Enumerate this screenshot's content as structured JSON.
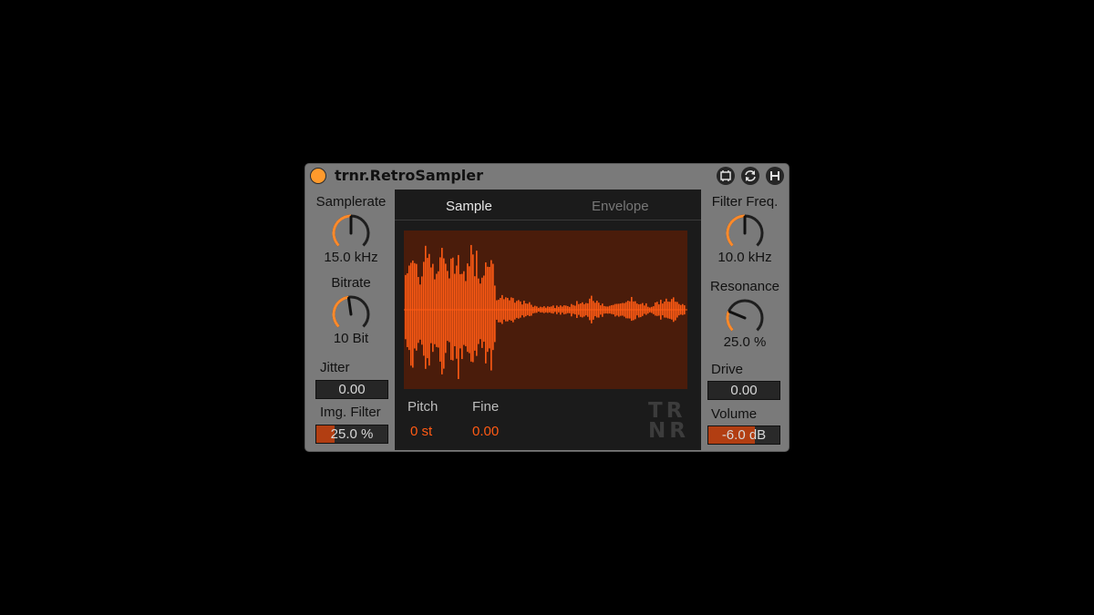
{
  "device": {
    "title": "trnr.RetroSampler",
    "colors": {
      "accent": "#ff5a14",
      "knob": "#ff8a2a",
      "panel": "#7a7a7a",
      "dark": "#1b1b1b",
      "waveform_bg": "#4a1c0b",
      "power": "#ff9a2c"
    }
  },
  "title_bar": {
    "icons": [
      "hotswap-icon",
      "refresh-icon",
      "save-icon"
    ]
  },
  "left": {
    "samplerate": {
      "label": "Samplerate",
      "value": "15.0 kHz",
      "level": 0.5
    },
    "bitrate": {
      "label": "Bitrate",
      "value": "10 Bit",
      "level": 0.47
    },
    "jitter": {
      "label": "Jitter",
      "value": "0.00"
    },
    "img_filter": {
      "label": "Img. Filter",
      "value": "25.0 %",
      "level": 0.25
    }
  },
  "center": {
    "tabs": [
      {
        "label": "Sample",
        "active": true
      },
      {
        "label": "Envelope",
        "active": false
      }
    ],
    "pitch": {
      "label": "Pitch",
      "value": "0 st"
    },
    "fine": {
      "label": "Fine",
      "value": "0.00"
    },
    "logo": {
      "line1": "TR",
      "line2": "NR"
    }
  },
  "right": {
    "filter_freq": {
      "label": "Filter Freq.",
      "value": "10.0 kHz",
      "level": 0.5
    },
    "resonance": {
      "label": "Resonance",
      "value": "25.0 %",
      "level": 0.25
    },
    "drive": {
      "label": "Drive",
      "value": "0.00"
    },
    "volume": {
      "label": "Volume",
      "value": "-6.0 dB",
      "level": 0.65
    }
  }
}
